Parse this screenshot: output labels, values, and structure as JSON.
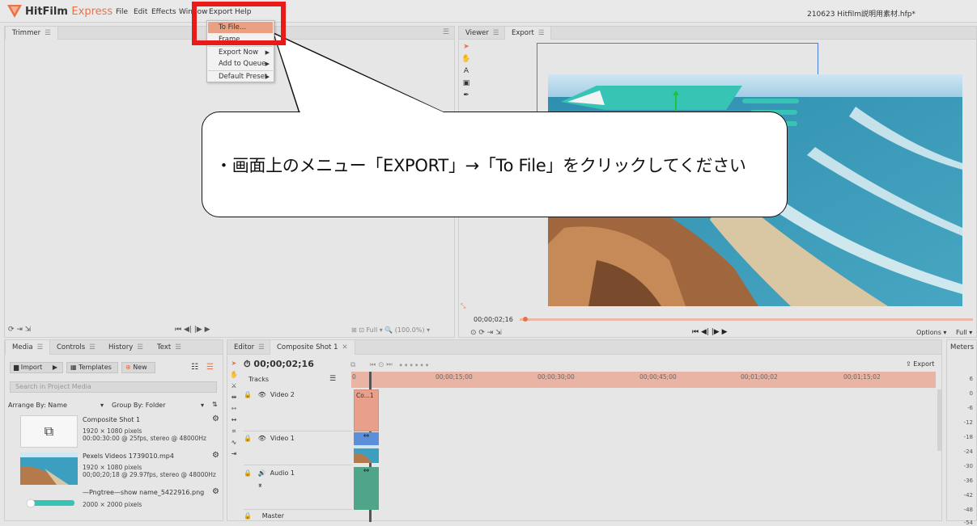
{
  "app": {
    "name": "HitFilm",
    "edition": "Express",
    "project_title": "210623 Hitfilm説明用素材.hfp*"
  },
  "menu": [
    "File",
    "Edit",
    "Effects",
    "Window",
    "Export",
    "Help"
  ],
  "export_menu": {
    "items": [
      {
        "label": "To File...",
        "highlighted": true,
        "submenu": false
      },
      {
        "label": "Frame",
        "highlighted": false,
        "submenu": false
      },
      {
        "label": "Export Now",
        "highlighted": false,
        "submenu": true
      },
      {
        "label": "Add to Queue",
        "highlighted": false,
        "submenu": true
      },
      {
        "label": "Default Preset",
        "highlighted": false,
        "submenu": true
      }
    ]
  },
  "callout": {
    "text": "・画面上のメニュー「EXPORT」→「To File」をクリックしてください"
  },
  "trimmer": {
    "tab": "Trimmer",
    "zoom": "Full",
    "zoom_percent": "(100.0%)"
  },
  "viewer": {
    "tabs": [
      "Viewer",
      "Export"
    ],
    "timecode": "00;00;02;16",
    "options": "Options",
    "zoom": "Full"
  },
  "media_panel": {
    "tabs": [
      "Media",
      "Controls",
      "History",
      "Text"
    ],
    "import": "Import",
    "templates": "Templates",
    "new": "New",
    "search_placeholder": "Search in Project Media",
    "arrange": "Arrange By: Name",
    "group": "Group By: Folder",
    "items": [
      {
        "name": "Composite Shot 1",
        "line1": "1920 × 1080 pixels",
        "line2": "00:00:30:00 @ 25fps, stereo @ 48000Hz"
      },
      {
        "name": "Pexels Videos 1739010.mp4",
        "line1": "1920 × 1080 pixels",
        "line2": "00;00;20;18 @ 29.97fps, stereo @ 48000Hz"
      },
      {
        "name": "—Pngtree—show name_5422916.png",
        "line1": "2000 × 2000 pixels",
        "line2": ""
      }
    ]
  },
  "editor": {
    "tabs": [
      "Editor",
      "Composite Shot 1"
    ],
    "timecode": "00;00;02;16",
    "tracks_label": "Tracks",
    "export": "Export",
    "ruler": [
      "0",
      "00;00;15;00",
      "00;00;30;00",
      "00;00;45;00",
      "00;01;00;02",
      "00;01;15;02"
    ],
    "tracks": [
      "Video 2",
      "Video 1",
      "Audio 1",
      "Master"
    ],
    "clip_label": "Co...1"
  },
  "meters": {
    "title": "Meters",
    "scale": [
      "6",
      "0",
      "-6",
      "-12",
      "-18",
      "-24",
      "-30",
      "-36",
      "-42",
      "-48",
      "-54"
    ]
  },
  "colors": {
    "accent": "#e8734a",
    "highlight": "#e9a083",
    "callout_border": "#e81a1a",
    "clip_video": "#e9a08a",
    "clip_blue": "#5b8fd9",
    "clip_audio": "#4fa58a"
  }
}
